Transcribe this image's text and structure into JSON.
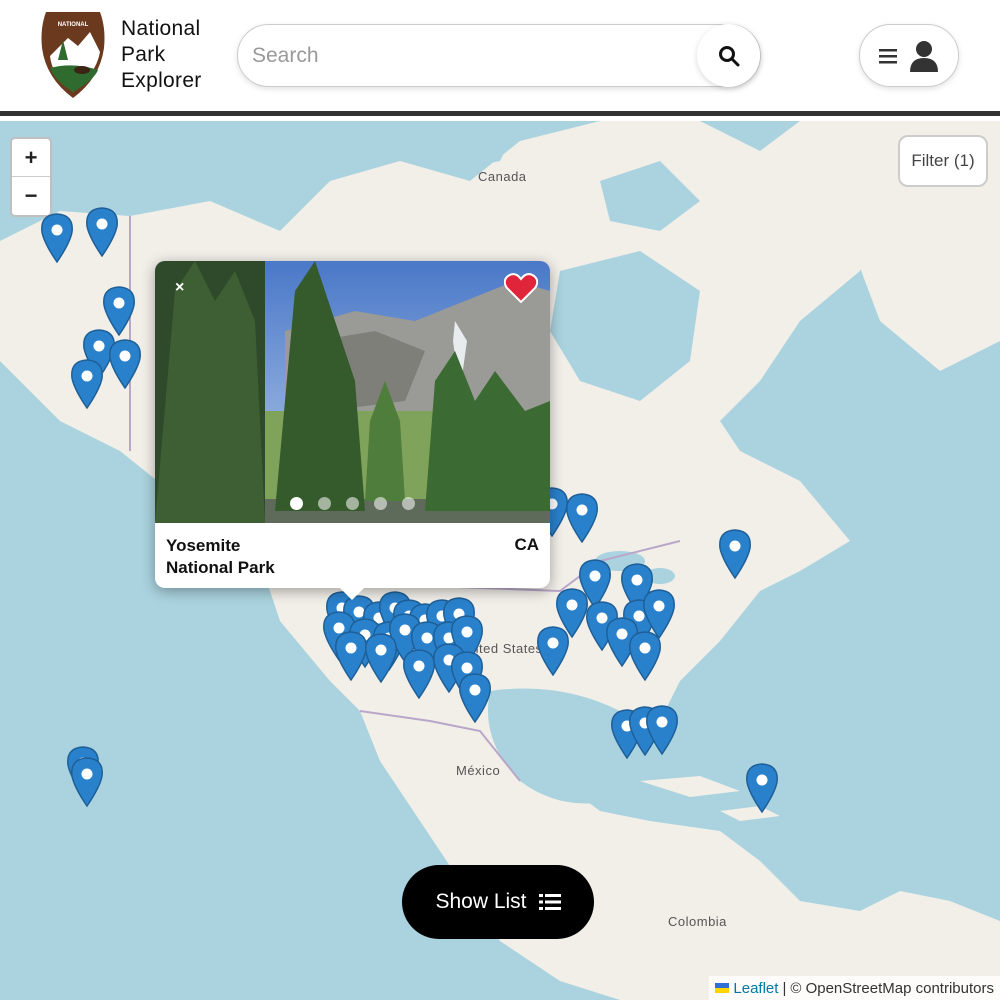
{
  "app": {
    "brand_line1": "National",
    "brand_line2": "Park",
    "brand_line3": "Explorer",
    "logo_text": "NATIONAL PARK SERVICE"
  },
  "search": {
    "placeholder": "Search",
    "value": "",
    "icon": "search-icon"
  },
  "menu": {
    "icons": [
      "hamburger-icon",
      "user-icon"
    ]
  },
  "map": {
    "zoom_in": "+",
    "zoom_out": "−",
    "filter_label": "Filter (1)",
    "labels": {
      "canada": "Canada",
      "usa": "United States",
      "mexico": "México",
      "colombia": "Colombia"
    }
  },
  "popup": {
    "close": "×",
    "park_name_line1": "Yosemite",
    "park_name_line2": "National Park",
    "state": "CA",
    "favorited": true,
    "image_count": 5,
    "active_image": 1
  },
  "show_list": {
    "label": "Show List",
    "icon": "list-icon"
  },
  "attribution": {
    "leaflet": "Leaflet",
    "separator": "|",
    "copyright": "© OpenStreetMap contributors"
  },
  "colors": {
    "water": "#aad3df",
    "land": "#f2efe9",
    "pin": "#2a81cb",
    "heart": "#e0243a",
    "header_border": "#333333"
  }
}
